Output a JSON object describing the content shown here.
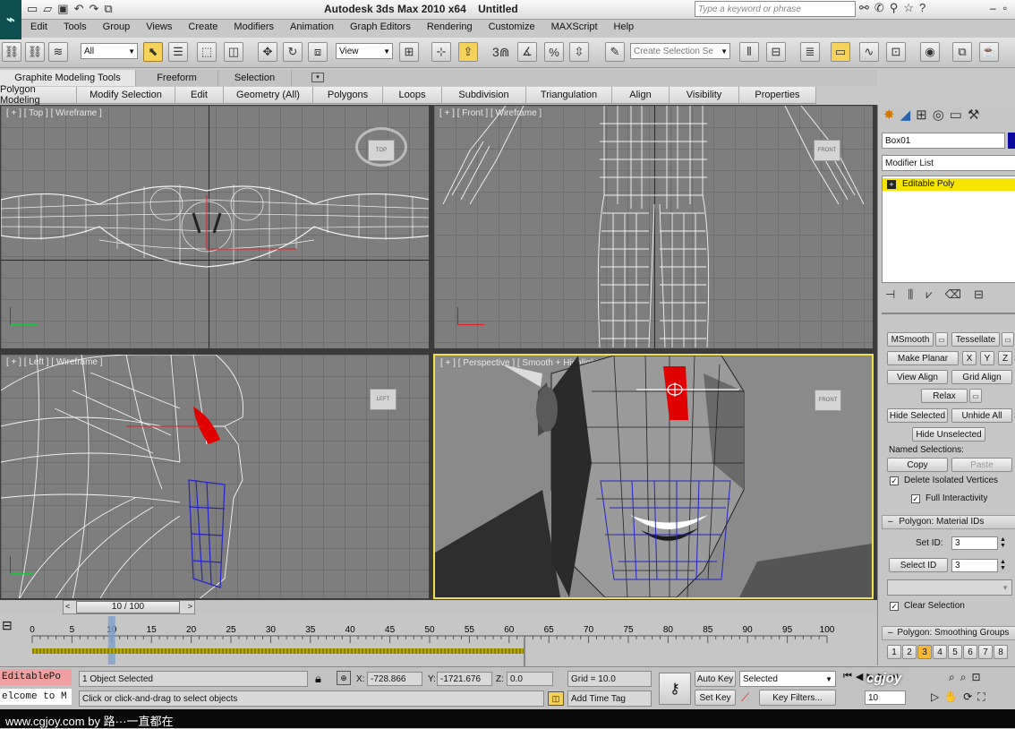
{
  "title_bar": {
    "app_title": "Autodesk 3ds Max  2010 x64",
    "doc_title": "Untitled",
    "search_placeholder": "Type a keyword or phrase"
  },
  "menu": [
    "Edit",
    "Tools",
    "Group",
    "Views",
    "Create",
    "Modifiers",
    "Animation",
    "Graph Editors",
    "Rendering",
    "Customize",
    "MAXScript",
    "Help"
  ],
  "toolbar": {
    "selection_filter": "All",
    "ref_coord": "View",
    "named_selection_placeholder": "Create Selection Se",
    "snap_label": "3"
  },
  "ribbon": {
    "tabs": [
      "Graphite Modeling Tools",
      "Freeform",
      "Selection"
    ],
    "panels": [
      "Polygon Modeling",
      "Modify Selection",
      "Edit",
      "Geometry (All)",
      "Polygons",
      "Loops",
      "Subdivision",
      "Triangulation",
      "Align",
      "Visibility",
      "Properties"
    ]
  },
  "viewports": [
    {
      "label": "[ + ] [ Top ] [ Wireframe ]",
      "cube": "TOP"
    },
    {
      "label": "[ + ] [ Front ] [ Wireframe ]",
      "cube": "FRONT"
    },
    {
      "label": "[ + ] [ Left ] [ Wireframe ]",
      "cube": "LEFT"
    },
    {
      "label": "[ + ] [ Perspective ] [ Smooth + Highlights + Edged Faces ]",
      "cube": "FRONT"
    }
  ],
  "command_panel": {
    "object_name": "Box01",
    "modifier_list": "Modifier List",
    "stack_item": "Editable Poly",
    "buttons": {
      "msmooth": "MSmooth",
      "tessellate": "Tessellate",
      "make_planar": "Make Planar",
      "x": "X",
      "y": "Y",
      "z": "Z",
      "view_align": "View Align",
      "grid_align": "Grid Align",
      "relax": "Relax",
      "hide_selected": "Hide Selected",
      "unhide_all": "Unhide All",
      "hide_unselected": "Hide Unselected",
      "copy": "Copy",
      "paste": "Paste",
      "select_id": "Select ID"
    },
    "named_selections": "Named Selections:",
    "delete_isolated": "Delete Isolated Vertices",
    "full_interactivity": "Full Interactivity",
    "material_ids_rollout": "Polygon: Material IDs",
    "set_id_label": "Set ID:",
    "set_id_value": "3",
    "select_id_value": "3",
    "clear_selection": "Clear Selection",
    "smoothing_rollout": "Polygon: Smoothing Groups",
    "smoothing_groups": [
      "1",
      "2",
      "3",
      "4",
      "5",
      "6",
      "7",
      "8"
    ]
  },
  "timeline": {
    "frame_display": "10 / 100",
    "ticks": [
      "0",
      "5",
      "10",
      "15",
      "20",
      "25",
      "30",
      "35",
      "40",
      "45",
      "50",
      "55",
      "60",
      "65",
      "70",
      "75",
      "80",
      "85",
      "90",
      "95",
      "100"
    ],
    "current_frame": 10,
    "total_frames": 100
  },
  "status": {
    "listener_1": "EditablePo",
    "listener_2": "elcome to M",
    "selection": "1 Object Selected",
    "prompt": "Click or click-and-drag to select objects",
    "x_label": "X:",
    "x_value": "-728.866",
    "y_label": "Y:",
    "y_value": "-1721.676",
    "z_label": "Z:",
    "z_value": "0.0",
    "grid": "Grid = 10.0",
    "add_time_tag": "Add Time Tag",
    "auto_key": "Auto Key",
    "set_key": "Set Key",
    "key_mode": "Selected",
    "key_filters": "Key Filters...",
    "frame_field": "10"
  },
  "footer": {
    "watermark": "www.cgjoy.com by 路···一直都在",
    "logo": "cgjoy"
  },
  "colors": {
    "accent_yellow": "#f5e400",
    "selection_red": "#e00000",
    "active_border": "#f0e050",
    "wire_blue": "#2020c0"
  }
}
